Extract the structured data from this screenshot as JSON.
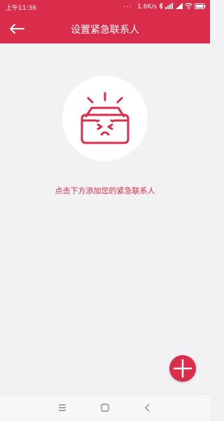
{
  "status_bar": {
    "time": "上午11:36",
    "more": "...",
    "network_speed": "1.6K/s"
  },
  "header": {
    "title": "设置紧急联系人",
    "back_icon": "back-arrow-icon"
  },
  "empty_state": {
    "icon": "empty-inbox-icon",
    "hint": "点击下方添加您的紧急联系人"
  },
  "fab": {
    "icon": "plus-icon"
  },
  "nav_bar": {
    "icons": [
      "menu-icon",
      "home-icon",
      "back-chevron-icon"
    ]
  },
  "colors": {
    "accent": "#da2c4b",
    "background": "#f2f2f4"
  }
}
